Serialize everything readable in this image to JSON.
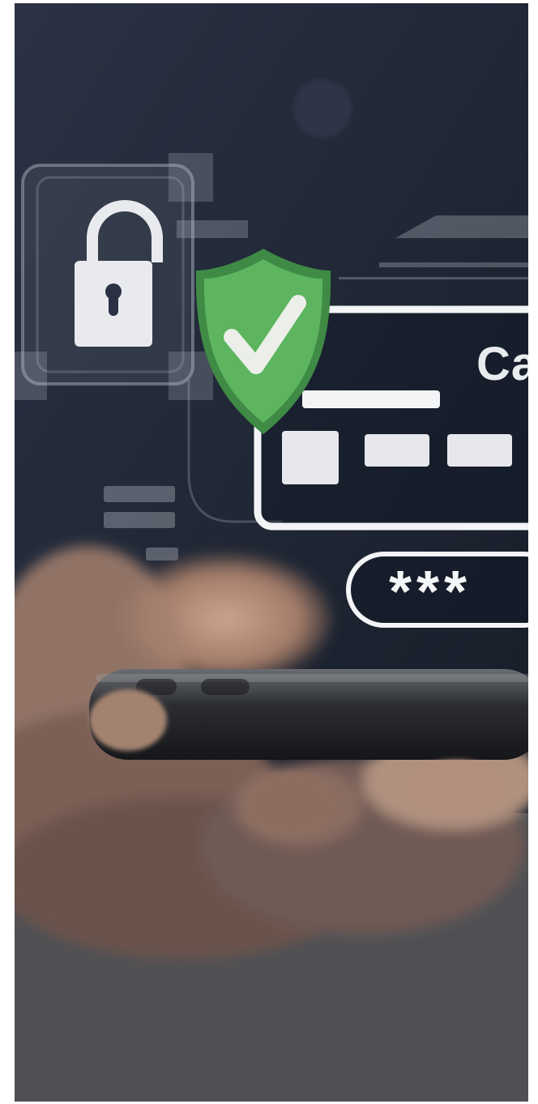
{
  "overlay": {
    "card_label": "Ca",
    "password_mask": "***"
  },
  "icons": [
    "lock-icon",
    "shield-check-icon"
  ],
  "colors": {
    "background": "#1f2a3a",
    "shield_green": "#5db55f",
    "check_white": "#ecefe9",
    "overlay_white": "#e9ecef"
  }
}
